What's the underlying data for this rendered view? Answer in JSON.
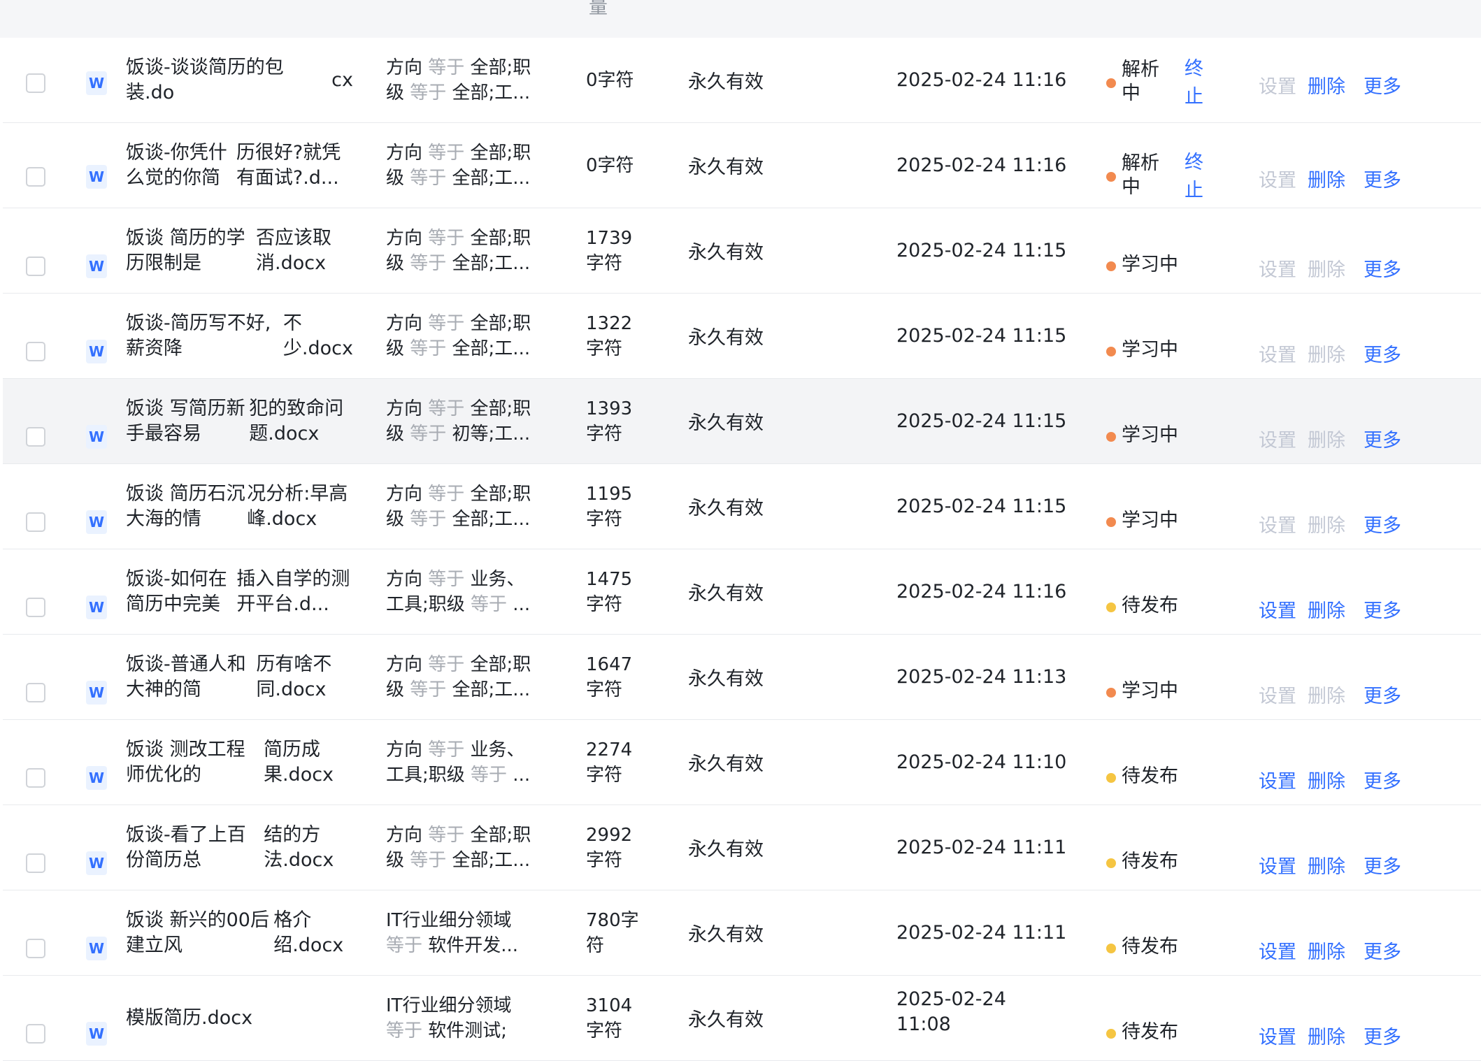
{
  "header": {
    "fragment": "量"
  },
  "condition_op": "等于",
  "actions": {
    "set": "设置",
    "delete": "删除",
    "more": "更多",
    "stop": "终止"
  },
  "rows": [
    {
      "name": [
        "饭谈-谈谈简历的包装.do",
        "cx"
      ],
      "cond": [
        [
          "方向 ",
          "等于",
          " 全部;职"
        ],
        [
          "级 ",
          "等于",
          " 全部;工..."
        ]
      ],
      "chars": [
        "0字符"
      ],
      "validity": "永久有效",
      "time": [
        "2025-02-24 11:16"
      ],
      "status": [
        "解析",
        "中"
      ],
      "dot": "orange",
      "stop": true,
      "enabled": false
    },
    {
      "name": [
        "饭谈-你凭什么觉的你简",
        "历很好?就凭有面试?.d..."
      ],
      "cond": [
        [
          "方向 ",
          "等于",
          " 全部;职"
        ],
        [
          "级 ",
          "等于",
          " 全部;工..."
        ]
      ],
      "chars": [
        "0字符"
      ],
      "validity": "永久有效",
      "time": [
        "2025-02-24 11:16"
      ],
      "status": [
        "解析",
        "中"
      ],
      "dot": "orange",
      "stop": true,
      "enabled": false
    },
    {
      "name": [
        "饭谈 简历的学历限制是",
        "否应该取消.docx"
      ],
      "cond": [
        [
          "方向 ",
          "等于",
          " 全部;职"
        ],
        [
          "级 ",
          "等于",
          " 全部;工..."
        ]
      ],
      "chars": [
        "1739",
        "字符"
      ],
      "validity": "永久有效",
      "time": [
        "2025-02-24 11:15"
      ],
      "status": [
        "学习中"
      ],
      "dot": "orange",
      "stop": false,
      "enabled": false
    },
    {
      "name": [
        "饭谈-简历写不好,薪资降",
        "不少.docx"
      ],
      "cond": [
        [
          "方向 ",
          "等于",
          " 全部;职"
        ],
        [
          "级 ",
          "等于",
          " 全部;工..."
        ]
      ],
      "chars": [
        "1322",
        "字符"
      ],
      "validity": "永久有效",
      "time": [
        "2025-02-24 11:15"
      ],
      "status": [
        "学习中"
      ],
      "dot": "orange",
      "stop": false,
      "enabled": false
    },
    {
      "name": [
        "饭谈 写简历新手最容易",
        "犯的致命问题.docx"
      ],
      "cond": [
        [
          "方向 ",
          "等于",
          " 全部;职"
        ],
        [
          "级 ",
          "等于",
          " 初等;工..."
        ]
      ],
      "chars": [
        "1393",
        "字符"
      ],
      "validity": "永久有效",
      "time": [
        "2025-02-24 11:15"
      ],
      "status": [
        "学习中"
      ],
      "dot": "orange",
      "stop": false,
      "enabled": false,
      "highlight": true
    },
    {
      "name": [
        "饭谈 简历石沉大海的情",
        "况分析:早高峰.docx"
      ],
      "cond": [
        [
          "方向 ",
          "等于",
          " 全部;职"
        ],
        [
          "级 ",
          "等于",
          " 全部;工..."
        ]
      ],
      "chars": [
        "1195",
        "字符"
      ],
      "validity": "永久有效",
      "time": [
        "2025-02-24 11:15"
      ],
      "status": [
        "学习中"
      ],
      "dot": "orange",
      "stop": false,
      "enabled": false
    },
    {
      "name": [
        "饭谈-如何在简历中完美",
        "插入自学的测开平台.d..."
      ],
      "cond": [
        [
          "方向 ",
          "等于",
          " 业务、"
        ],
        [
          "工具;职级 ",
          "等于",
          " ..."
        ]
      ],
      "chars": [
        "1475",
        "字符"
      ],
      "validity": "永久有效",
      "time": [
        "2025-02-24 11:16"
      ],
      "status": [
        "待发布"
      ],
      "dot": "yellow",
      "stop": false,
      "enabled": true
    },
    {
      "name": [
        "饭谈-普通人和大神的简",
        "历有啥不同.docx"
      ],
      "cond": [
        [
          "方向 ",
          "等于",
          " 全部;职"
        ],
        [
          "级 ",
          "等于",
          " 全部;工..."
        ]
      ],
      "chars": [
        "1647",
        "字符"
      ],
      "validity": "永久有效",
      "time": [
        "2025-02-24 11:13"
      ],
      "status": [
        "学习中"
      ],
      "dot": "orange",
      "stop": false,
      "enabled": false
    },
    {
      "name": [
        "饭谈 测改工程师优化的",
        "简历成果.docx"
      ],
      "cond": [
        [
          "方向 ",
          "等于",
          " 业务、"
        ],
        [
          "工具;职级 ",
          "等于",
          " ..."
        ]
      ],
      "chars": [
        "2274",
        "字符"
      ],
      "validity": "永久有效",
      "time": [
        "2025-02-24 11:10"
      ],
      "status": [
        "待发布"
      ],
      "dot": "yellow",
      "stop": false,
      "enabled": true
    },
    {
      "name": [
        "饭谈-看了上百份简历总",
        "结的方法.docx"
      ],
      "cond": [
        [
          "方向 ",
          "等于",
          " 全部;职"
        ],
        [
          "级 ",
          "等于",
          " 全部;工..."
        ]
      ],
      "chars": [
        "2992",
        "字符"
      ],
      "validity": "永久有效",
      "time": [
        "2025-02-24 11:11"
      ],
      "status": [
        "待发布"
      ],
      "dot": "yellow",
      "stop": false,
      "enabled": true
    },
    {
      "name": [
        "饭谈 新兴的00后建立风",
        "格介绍.docx"
      ],
      "cond": [
        [
          "IT行业细分领域",
          "",
          ""
        ],
        [
          "",
          "等于",
          " 软件开发..."
        ]
      ],
      "chars": [
        "780字",
        "符"
      ],
      "validity": "永久有效",
      "time": [
        "2025-02-24 11:11"
      ],
      "status": [
        "待发布"
      ],
      "dot": "yellow",
      "stop": false,
      "enabled": true
    },
    {
      "name": [
        "模版简历.docx"
      ],
      "cond": [
        [
          "IT行业细分领域",
          "",
          ""
        ],
        [
          "",
          "等于",
          " 软件测试;"
        ]
      ],
      "chars": [
        "3104",
        "字符"
      ],
      "validity": "永久有效",
      "time": [
        "2025-02-24",
        "11:08"
      ],
      "status": [
        "待发布"
      ],
      "dot": "yellow",
      "stop": false,
      "enabled": true
    }
  ]
}
